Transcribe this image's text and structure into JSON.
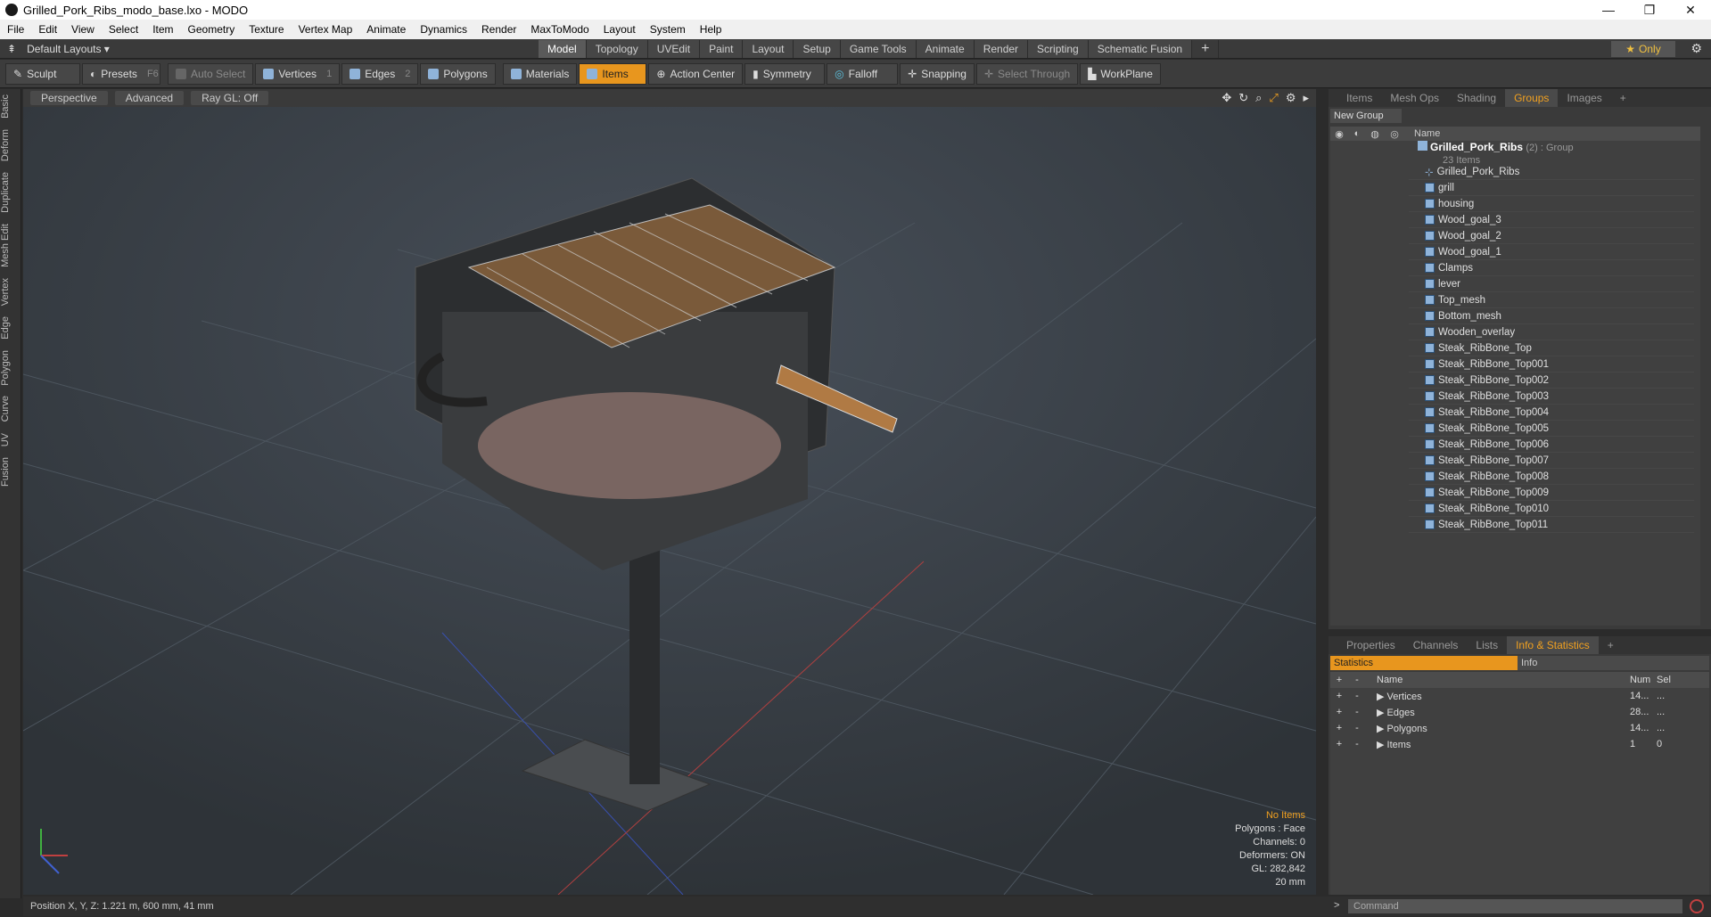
{
  "window": {
    "title": "Grilled_Pork_Ribs_modo_base.lxo - MODO",
    "controls": [
      "—",
      "❐",
      "✕"
    ]
  },
  "menu": [
    "File",
    "Edit",
    "View",
    "Select",
    "Item",
    "Geometry",
    "Texture",
    "Vertex Map",
    "Animate",
    "Dynamics",
    "Render",
    "MaxToModo",
    "Layout",
    "System",
    "Help"
  ],
  "layout": {
    "label": "Default Layouts",
    "tabs": [
      "Model",
      "Topology",
      "UVEdit",
      "Paint",
      "Layout",
      "Setup",
      "Game Tools",
      "Animate",
      "Render",
      "Scripting",
      "Schematic Fusion"
    ],
    "active_tab": "Model",
    "add": "+",
    "only_label": "Only"
  },
  "toolbar": {
    "sculpt": "Sculpt",
    "presets": "Presets",
    "presets_key": "F6",
    "auto_select": "Auto Select",
    "vertices": "Vertices",
    "vertices_key": "1",
    "edges": "Edges",
    "edges_key": "2",
    "polygons": "Polygons",
    "materials": "Materials",
    "items": "Items",
    "action_center": "Action Center",
    "symmetry": "Symmetry",
    "falloff": "Falloff",
    "snapping": "Snapping",
    "select_through": "Select Through",
    "workplane": "WorkPlane"
  },
  "left_tabs": [
    "Basic",
    "Deform",
    "Duplicate",
    "Mesh Edit",
    "Vertex",
    "Edge",
    "Polygon",
    "Curve",
    "UV",
    "Fusion"
  ],
  "viewport": {
    "view": "Perspective",
    "shading": "Advanced",
    "raygl": "Ray GL: Off",
    "info": {
      "selection": "No Items",
      "polygons": "Polygons : Face",
      "channels": "Channels: 0",
      "deformers": "Deformers: ON",
      "gl": "GL: 282,842",
      "scale": "20 mm"
    }
  },
  "status": {
    "position": "Position X, Y, Z:   1.221 m, 600 mm, 41 mm"
  },
  "groups_panel": {
    "tabs": [
      "Items",
      "Mesh Ops",
      "Shading",
      "Groups",
      "Images",
      "+"
    ],
    "active_tab": "Groups",
    "new_group": "New Group",
    "name_header": "Name",
    "group_name": "Grilled_Pork_Ribs",
    "group_suffix": "(2) : Group",
    "group_count": "23 Items",
    "items": [
      "Grilled_Pork_Ribs",
      "grill",
      "housing",
      "Wood_goal_3",
      "Wood_goal_2",
      "Wood_goal_1",
      "Clamps",
      "lever",
      "Top_mesh",
      "Bottom_mesh",
      "Wooden_overlay",
      "Steak_RibBone_Top",
      "Steak_RibBone_Top001",
      "Steak_RibBone_Top002",
      "Steak_RibBone_Top003",
      "Steak_RibBone_Top004",
      "Steak_RibBone_Top005",
      "Steak_RibBone_Top006",
      "Steak_RibBone_Top007",
      "Steak_RibBone_Top008",
      "Steak_RibBone_Top009",
      "Steak_RibBone_Top010",
      "Steak_RibBone_Top011"
    ]
  },
  "stats_panel": {
    "tabs": [
      "Properties",
      "Channels",
      "Lists",
      "Info & Statistics",
      "+"
    ],
    "active_tab": "Info & Statistics",
    "statistics": "Statistics",
    "info": "Info",
    "headers": {
      "name": "Name",
      "num": "Num",
      "sel": "Sel"
    },
    "rows": [
      {
        "name": "Vertices",
        "num": "14...",
        "sel": "..."
      },
      {
        "name": "Edges",
        "num": "28...",
        "sel": "..."
      },
      {
        "name": "Polygons",
        "num": "14...",
        "sel": "..."
      },
      {
        "name": "Items",
        "num": "1",
        "sel": "0"
      }
    ]
  },
  "command": {
    "placeholder": "Command"
  },
  "colors": {
    "accent": "#e8961e",
    "bg": "#393f45"
  }
}
